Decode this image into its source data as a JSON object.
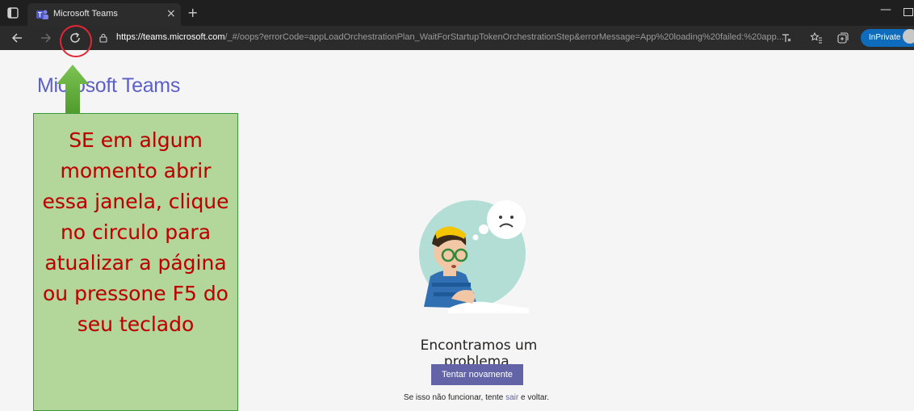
{
  "browser": {
    "tab_title": "Microsoft Teams",
    "tab_close": "×",
    "new_tab": "+",
    "minimize": "—",
    "url_host": "https://teams.microsoft.com",
    "url_path": "/_#/oops?errorCode=appLoadOrchestrationPlan_WaitForStartupTokenOrchestrationStep&errorMessage=App%20loading%20failed:%20app...",
    "inprivate_label": "InPrivate",
    "icons": [
      "tab-actions-icon",
      "teams-favicon-icon",
      "back-icon",
      "forward-icon",
      "refresh-icon",
      "lock-icon",
      "read-aloud-icon",
      "favorites-icon",
      "collections-icon",
      "avatar"
    ]
  },
  "page": {
    "brand": "Microsoft Teams",
    "error_title": "Encontramos um problema.",
    "retry_label": "Tentar novamente",
    "hint_before": "Se isso não funcionar, tente ",
    "hint_link": "sair",
    "hint_after": " e voltar."
  },
  "annotation": {
    "lines": [
      "SE em algum",
      "momento abrir",
      "essa janela, clique",
      "no circulo para",
      "atualizar a página",
      "ou pressone F5 do",
      "seu teclado"
    ],
    "colors": {
      "box": "#b3d79b",
      "border": "#3a9a3a",
      "text": "#c00000",
      "arrow": "#5fae3c",
      "circle": "#e32636"
    }
  },
  "colors": {
    "accent": "#5b5fc7",
    "button": "#6264a7",
    "titlebar": "#1f1f1f",
    "toolbar": "#2b2b2b"
  }
}
